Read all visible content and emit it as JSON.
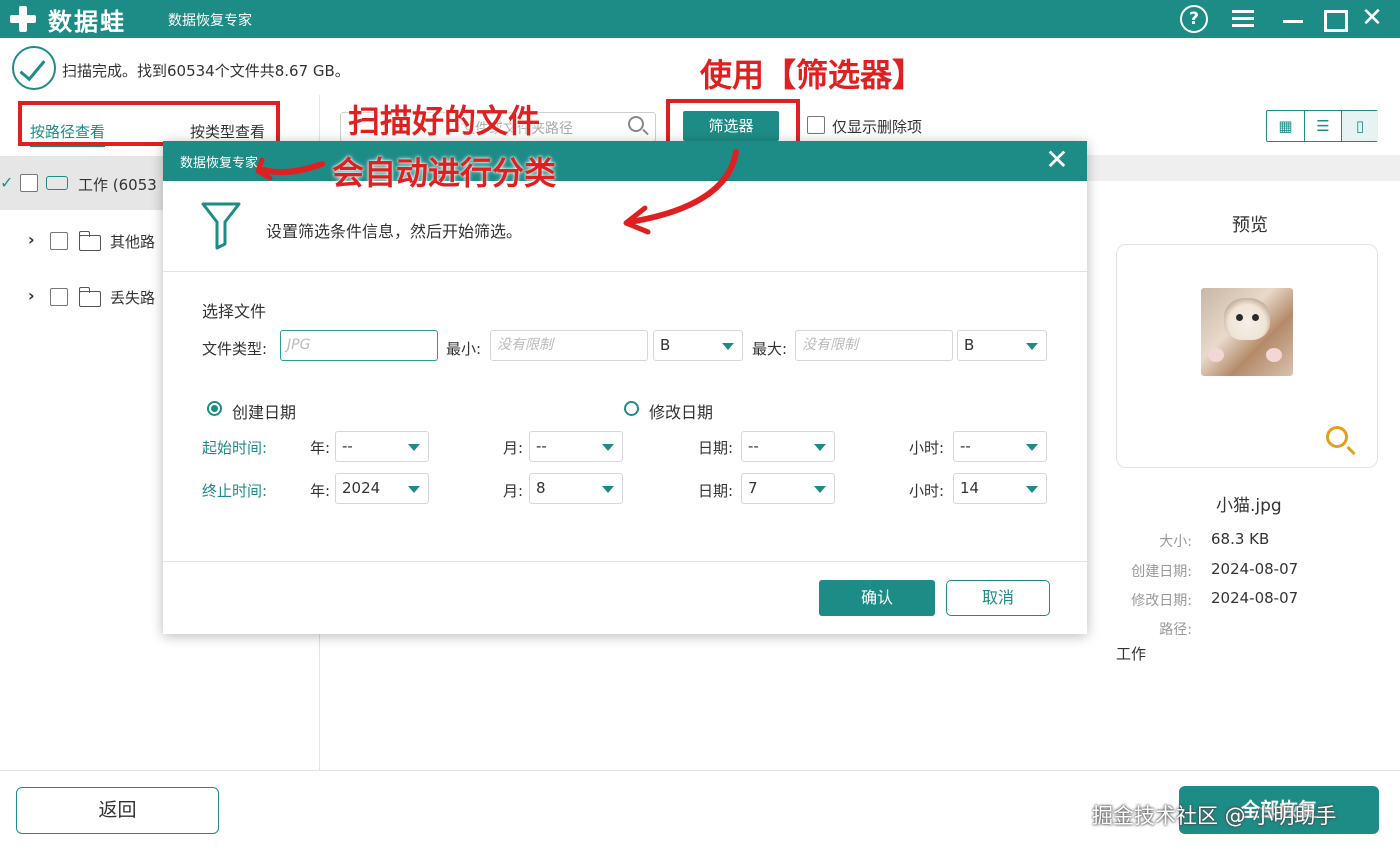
{
  "window": {
    "brand": "数据蛙",
    "subtitle": "数据恢复专家",
    "icons": [
      "help-icon",
      "menu-icon",
      "minimize-icon",
      "maximize-icon",
      "close-icon"
    ]
  },
  "status": {
    "text": "扫描完成。找到60534个文件共8.67 GB。"
  },
  "view_tabs": {
    "by_path": "按路径查看",
    "by_type": "按类型查看"
  },
  "tree": [
    {
      "label": "工作 (6053",
      "icon": "drive-icon"
    },
    {
      "label": "其他路",
      "icon": "folder-icon"
    },
    {
      "label": "丢失路",
      "icon": "folder-icon"
    }
  ],
  "toolbar": {
    "search_placeholder": "文件或文件夹路径",
    "filter_label": "筛选器",
    "deleted_only_label": "仅显示删除项"
  },
  "preview": {
    "title": "预览",
    "file_name": "小猫.jpg",
    "meta": [
      {
        "key": "大小:",
        "value": "68.3 KB"
      },
      {
        "key": "创建日期:",
        "value": "2024-08-07"
      },
      {
        "key": "修改日期:",
        "value": "2024-08-07"
      },
      {
        "key": "路径:",
        "value": ""
      }
    ],
    "path_value": "工作"
  },
  "bottom": {
    "back_label": "返回",
    "recover_all_label": "全部恢复",
    "watermark": "掘金技术社区 @ 小明助手"
  },
  "dialog": {
    "title": "数据恢复专家",
    "hint": "设置筛选条件信息，然后开始筛选。",
    "section_label": "选择文件",
    "file_type_label": "文件类型:",
    "file_type_placeholder": "JPG",
    "min_label": "最小:",
    "min_placeholder": "没有限制",
    "min_unit": "B",
    "max_label": "最大:",
    "max_placeholder": "没有限制",
    "max_unit": "B",
    "date_mode_selected": "created",
    "created_label": "创建日期",
    "modified_label": "修改日期",
    "start_label": "起始时间:",
    "end_label": "终止时间:",
    "year_label": "年:",
    "month_label": "月:",
    "day_label": "日期:",
    "hour_label": "小时:",
    "start": {
      "year": "--",
      "month": "--",
      "day": "--",
      "hour": "--"
    },
    "end": {
      "year": "2024",
      "month": "8",
      "day": "7",
      "hour": "14"
    },
    "confirm_label": "确认",
    "cancel_label": "取消"
  },
  "annotations": {
    "use_filter": "使用【筛选器】",
    "scanned_files": "扫描好的文件",
    "auto_sort": "会自动进行分类"
  },
  "colors": {
    "accent": "#1e8c86",
    "annotation": "#e02020"
  }
}
